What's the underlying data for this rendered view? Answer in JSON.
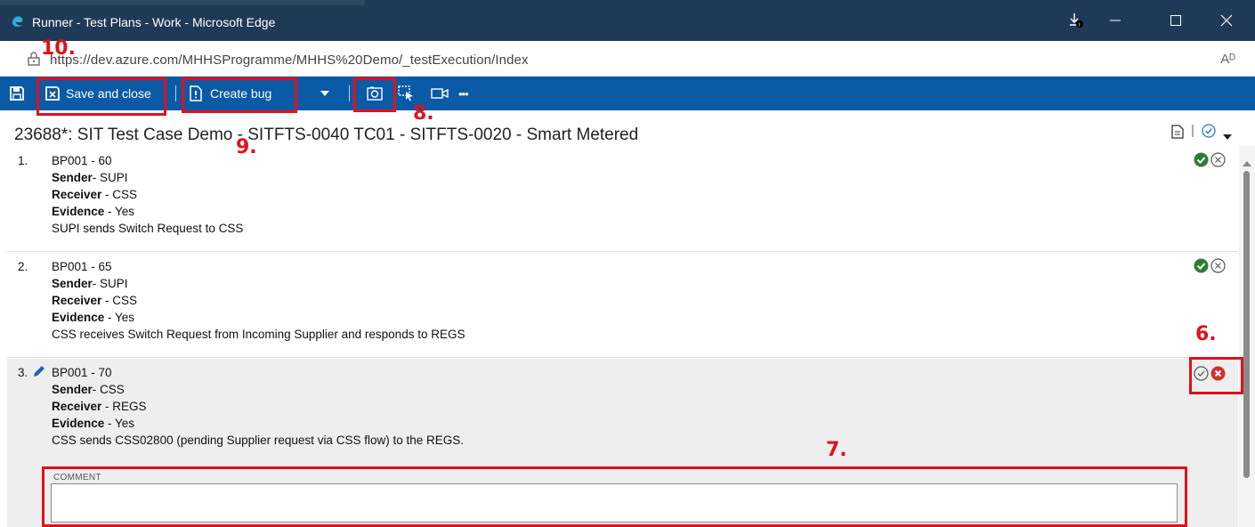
{
  "window": {
    "title": "Runner - Test Plans - Work - Microsoft Edge",
    "controls": [
      "download-icon",
      "minimize-icon",
      "maximize-icon",
      "close-icon"
    ]
  },
  "address": {
    "url": "https://dev.azure.com/MHHSProgramme/MHHS%20Demo/_testExecution/Index",
    "reader_icon": "Aᴰ"
  },
  "toolbar": {
    "save_close_label": "Save and close",
    "create_bug_label": "Create bug",
    "more_label": "•••"
  },
  "case": {
    "title": "23688*: SIT Test Case Demo - SITFTS-0040 TC01 - SITFTS-0020 - Smart Metered"
  },
  "steps": [
    {
      "number": "1.",
      "id": "BP001 - 60",
      "sender_label": "Sender",
      "sender": "- SUPI",
      "receiver_label": "Receiver",
      "receiver": " - CSS",
      "evidence_label": "Evidence",
      "evidence": " - Yes",
      "description": "SUPI sends Switch Request to CSS",
      "result": "passed"
    },
    {
      "number": "2.",
      "id": "BP001 - 65",
      "sender_label": "Sender",
      "sender": "- SUPI",
      "receiver_label": "Receiver",
      "receiver": " - CSS",
      "evidence_label": "Evidence",
      "evidence": " - Yes",
      "description": "CSS receives Switch Request from Incoming Supplier and responds to REGS",
      "result": "passed"
    },
    {
      "number": "3.",
      "id": "BP001 - 70",
      "sender_label": "Sender",
      "sender": "- CSS",
      "receiver_label": "Receiver",
      "receiver": " - REGS",
      "evidence_label": "Evidence",
      "evidence": " - Yes",
      "description": "CSS sends CSS02800 (pending Supplier request via CSS flow)  to the REGS.",
      "result": "failed"
    }
  ],
  "comment": {
    "label": "COMMENT",
    "value": ""
  },
  "annotations": {
    "n6": "6.",
    "n7": "7.",
    "n8": "8.",
    "n9": "9.",
    "n10": "10.",
    "color": "#e0101c"
  },
  "colors": {
    "titlebar": "#1f3a56",
    "toolbar": "#0a5aa5",
    "pass": "#2e7d32",
    "fail": "#d32f2f"
  }
}
